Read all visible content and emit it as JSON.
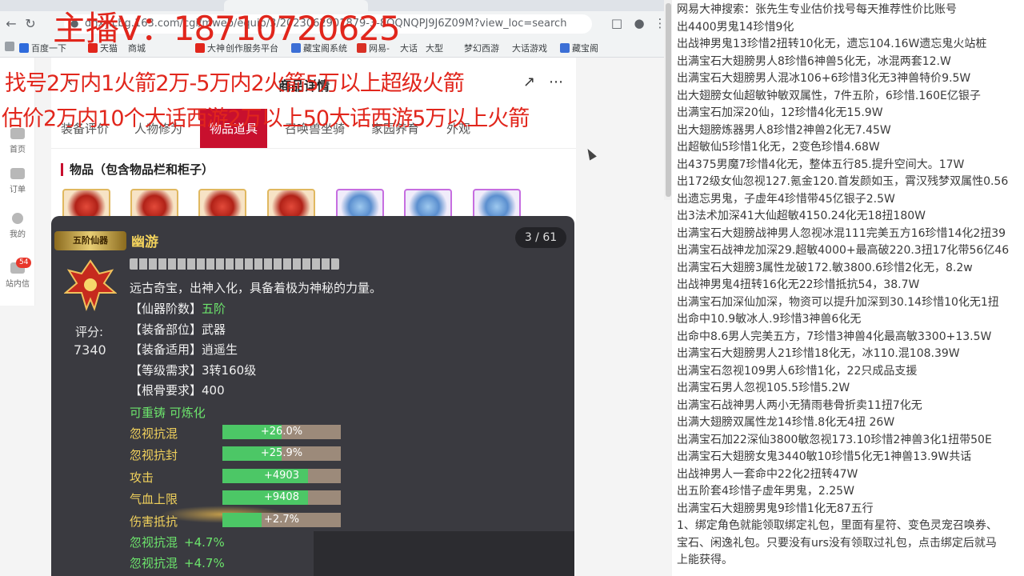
{
  "browser": {
    "url": "dhxy.cbg.163.com/cgi/mweb/equip/3/2023062901879-3-8OQNQPJ9J6Z09M?view_loc=search",
    "bookmarks": [
      "百度一下",
      "天猫",
      "商城",
      "大神",
      "创作服务平台",
      "藏宝阁系统",
      "网易-",
      "大话",
      "大型",
      "梦幻西游",
      "大话游戏",
      "藏宝阁"
    ],
    "nav_back_icon": "back-arrow-icon",
    "nav_reload_icon": "reload-icon"
  },
  "rail": {
    "items": [
      {
        "label": "首页",
        "icon": "home-icon"
      },
      {
        "label": "订单",
        "icon": "order-icon"
      },
      {
        "label": "我的",
        "icon": "user-icon"
      },
      {
        "label": "站内信",
        "icon": "mail-icon",
        "badge": "54"
      }
    ]
  },
  "page": {
    "detail_title": "商品详情",
    "subtabs": [
      "装备评价",
      "人物修为",
      "物品道具",
      "召唤兽坐骑",
      "家园养育",
      "外观"
    ],
    "active_subtab": "物品道具",
    "section_title": "物品（包含物品栏和柜子）"
  },
  "item": {
    "tier_badge": "五阶仙器",
    "name": "幽游",
    "counter": "3 / 61",
    "score_label": "评分:",
    "score": "7340",
    "description": "远古奇宝，出神入化，具备着极为神秘的力量。",
    "attrs": [
      {
        "key": "【仙器阶数】",
        "value": "五阶",
        "highlight": true
      },
      {
        "key": "【装备部位】",
        "value": "武器",
        "highlight": false
      },
      {
        "key": "【装备适用】",
        "value": "逍遥生",
        "highlight": false
      },
      {
        "key": "【等级需求】",
        "value": "3转160级",
        "highlight": false
      },
      {
        "key": "【根骨要求】",
        "value": "400",
        "highlight": false
      }
    ],
    "recast": "可重铸 可炼化",
    "stats": [
      {
        "name": "忽视抗混",
        "value": "+26.0%",
        "fill": 0.5
      },
      {
        "name": "忽视抗封",
        "value": "+25.9%",
        "fill": 0.5
      },
      {
        "name": "攻击",
        "value": "+4903",
        "fill": 0.72
      },
      {
        "name": "气血上限",
        "value": "+9408",
        "fill": 0.72
      },
      {
        "name": "伤害抵抗",
        "value": "+2.7%",
        "fill": 0.33
      }
    ],
    "bonuses": [
      {
        "name": "忽视抗混",
        "value": "+4.7%"
      },
      {
        "name": "忽视抗混",
        "value": "+4.7%"
      }
    ]
  },
  "overlay": {
    "contact": "主播V：18710720625",
    "line1": "找号2万内1火箭2万-5万内2火箭5万以上超级火箭",
    "line2": "估价2万内10个大话西游2万以上50大话西游5万以上火箭"
  },
  "notes": [
    "网易大神搜索：张先生专业估价找号每天推荐性价比账号",
    "出4400男鬼14珍惜9化",
    "出战神男鬼13珍惜2扭转10化无，遗忘104.16W遗忘鬼火站桩",
    "出满宝石大翅膀男人8珍惜6神兽5化无，冰混两套12.W",
    "出满宝石大翅膀男人混冰106+6珍惜3化无3神兽特价9.5W",
    "出大翅膀女仙超敏钟敏双属性，7件五阶，6珍惜.160E亿银子",
    "出满宝石加深20仙，12珍惜4化无15.9W",
    "出大翅膀炼器男人8珍惜2神兽2化无7.45W",
    "出超敏仙5珍惜1化无，2变色珍惜4.68W",
    "出4375男魔7珍惜4化无，整体五行85.提升空间大。17W",
    "出172级女仙忽视127.氪金120.首发颜如玉，霄汉残梦双属性0.56",
    "出遗忘男鬼，子虚年4珍惜带45亿银子2.5W",
    "出3法术加深41大仙超敏4150.24化无18扭180W",
    "出满宝石大翅膀战神男人忽视冰混111完美五方16珍惜14化2扭39",
    "出满宝石战神龙加深29.超敏4000+最高破220.3扭17化带56亿46",
    "出满宝石大翅膀3属性龙破172.敏3800.6珍惜2化无，8.2w",
    "出战神男鬼4扭转16化无22珍惜抵抗54，38.7W",
    "出满宝石加深仙加深，物资可以提升加深到30.14珍惜10化无1扭",
    "出命中10.9敏冰人.9珍惜3神兽6化无",
    "出命中8.6男人完美五方，7珍惜3神兽4化最高敏3300+13.5W",
    "出满宝石大翅膀男人21珍惜18化无，冰110.混108.39W",
    "出满宝石忽视109男人6珍惜1化，22只成品支援",
    "出满宝石男人忽视105.5珍惜5.2W",
    "出满宝石战神男人两小无猜雨巷骨折卖11扭7化无",
    "出满大翅膀双属性龙14珍惜.8化无4扭 26W",
    "出满宝石加22深仙3800敏忽视173.10珍惜2神兽3化1扭带50E",
    "出满宝石大翅膀女鬼3440敏10珍惜5化无1神兽13.9W共话",
    "出战神男人一套命中22化2扭转47W",
    "出五阶套4珍惜子虚年男鬼，2.25W",
    "出满宝石大翅膀男鬼9珍惜1化无87五行",
    "1、绑定角色就能领取绑定礼包，里面有星符、变色灵宠召唤券、",
    "宝石、闲逸礼包。只要没有urs没有领取过礼包，点击绑定后就马",
    "上能获得。"
  ]
}
